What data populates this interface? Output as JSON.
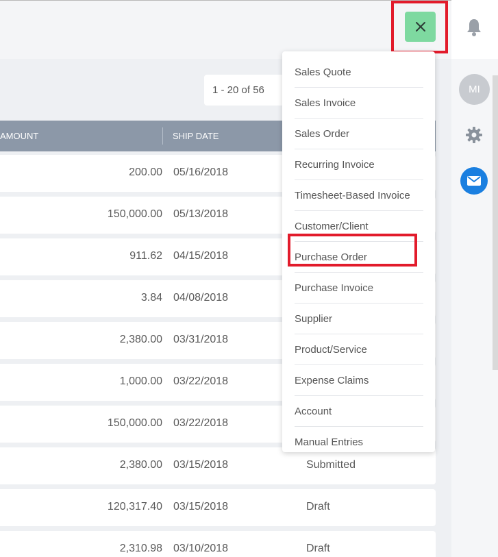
{
  "header": {
    "close_icon": "close-icon",
    "bell_icon": "bell-icon",
    "accent_color": "#7ed9a0",
    "highlight_color": "#e21b2b"
  },
  "sidebar": {
    "avatar_initials": "MI",
    "gear_icon": "gear-icon",
    "mail_icon": "mail-icon"
  },
  "pagination": {
    "label": "1 - 20 of 56"
  },
  "table": {
    "columns": {
      "amount": "AMOUNT",
      "ship_date": "SHIP DATE"
    },
    "rows": [
      {
        "amount": "200.00",
        "ship_date": "05/16/2018",
        "status": ""
      },
      {
        "amount": "150,000.00",
        "ship_date": "05/13/2018",
        "status": ""
      },
      {
        "amount": "911.62",
        "ship_date": "04/15/2018",
        "status": ""
      },
      {
        "amount": "3.84",
        "ship_date": "04/08/2018",
        "status": ""
      },
      {
        "amount": "2,380.00",
        "ship_date": "03/31/2018",
        "status": ""
      },
      {
        "amount": "1,000.00",
        "ship_date": "03/22/2018",
        "status": ""
      },
      {
        "amount": "150,000.00",
        "ship_date": "03/22/2018",
        "status": ""
      },
      {
        "amount": "2,380.00",
        "ship_date": "03/15/2018",
        "status": "Submitted"
      },
      {
        "amount": "120,317.40",
        "ship_date": "03/15/2018",
        "status": "Draft"
      },
      {
        "amount": "2,310.98",
        "ship_date": "03/10/2018",
        "status": "Draft"
      }
    ]
  },
  "menu": {
    "items": [
      "Sales Quote",
      "Sales Invoice",
      "Sales Order",
      "Recurring Invoice",
      "Timesheet-Based Invoice",
      "Customer/Client",
      "Purchase Order",
      "Purchase Invoice",
      "Supplier",
      "Product/Service",
      "Expense Claims",
      "Account",
      "Manual Entries"
    ]
  }
}
